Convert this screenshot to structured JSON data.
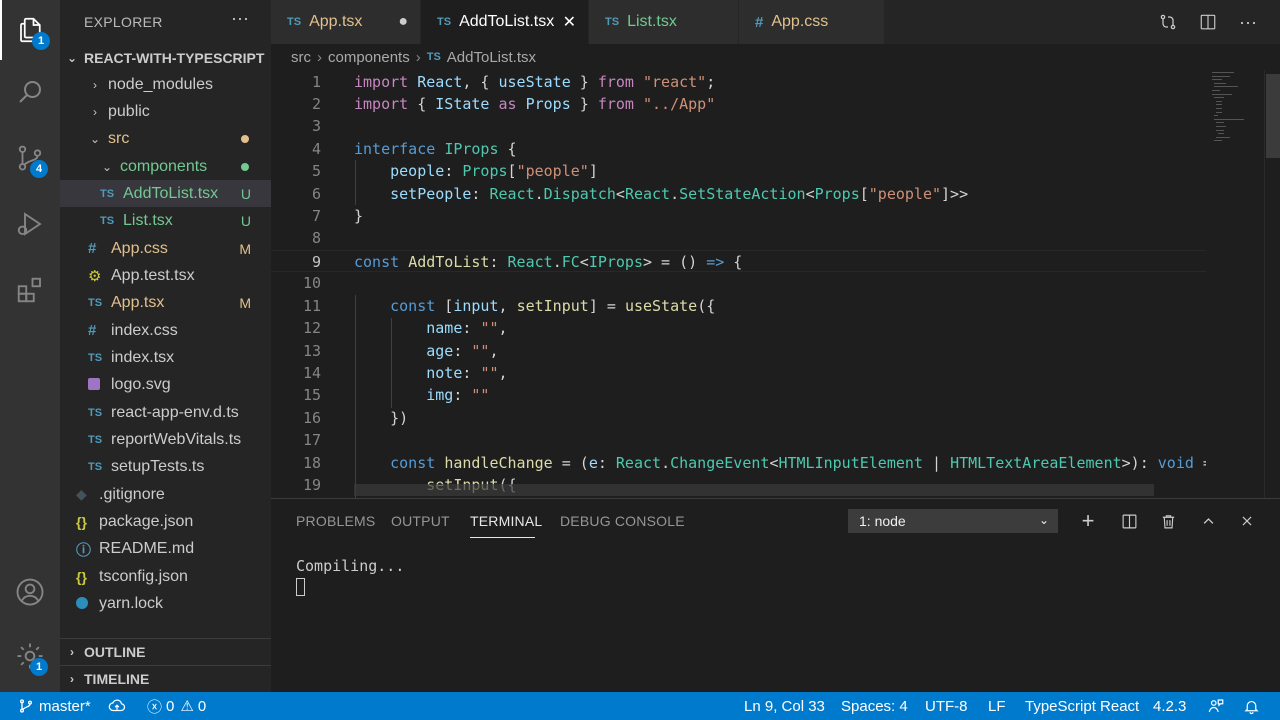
{
  "activity_bar": {
    "explorer_badge": "1",
    "scm_badge": "4",
    "manage_badge": "1"
  },
  "sidebar": {
    "title": "EXPLORER",
    "more": "···",
    "project": "REACT-WITH-TYPESCRIPT",
    "items": [
      {
        "label": "node_modules",
        "icon": "chevron-right",
        "color": "#cccccc"
      },
      {
        "label": "public",
        "icon": "chevron-right",
        "color": "#cccccc"
      },
      {
        "label": "src",
        "icon": "chevron-down",
        "color": "#e2c08d"
      },
      {
        "label": "components",
        "icon": "chevron-down",
        "color": "#73c991"
      },
      {
        "label": "AddToList.tsx",
        "icon": "TS",
        "status": "U",
        "color": "#73c991"
      },
      {
        "label": "List.tsx",
        "icon": "TS",
        "status": "U",
        "color": "#73c991"
      },
      {
        "label": "App.css",
        "icon": "#",
        "status": "M",
        "color": "#e2c08d"
      },
      {
        "label": "App.test.tsx",
        "icon": "gear",
        "color": "#cccccc"
      },
      {
        "label": "App.tsx",
        "icon": "TS",
        "status": "M",
        "color": "#e2c08d"
      },
      {
        "label": "index.css",
        "icon": "#",
        "color": "#cccccc"
      },
      {
        "label": "index.tsx",
        "icon": "TS",
        "color": "#cccccc"
      },
      {
        "label": "logo.svg",
        "icon": "svg",
        "color": "#cccccc"
      },
      {
        "label": "react-app-env.d.ts",
        "icon": "TS",
        "color": "#cccccc"
      },
      {
        "label": "reportWebVitals.ts",
        "icon": "TS",
        "color": "#cccccc"
      },
      {
        "label": "setupTests.ts",
        "icon": "TS",
        "color": "#cccccc"
      },
      {
        "label": ".gitignore",
        "icon": "git",
        "color": "#cccccc"
      },
      {
        "label": "package.json",
        "icon": "{}",
        "color": "#cccccc"
      },
      {
        "label": "README.md",
        "icon": "info",
        "color": "#cccccc"
      },
      {
        "label": "tsconfig.json",
        "icon": "{}",
        "color": "#cccccc"
      },
      {
        "label": "yarn.lock",
        "icon": "yarn",
        "color": "#cccccc"
      }
    ],
    "outline": "OUTLINE",
    "timeline": "TIMELINE"
  },
  "tabs": [
    {
      "icon": "TS",
      "label": "App.tsx",
      "state": "●",
      "active": false,
      "color": "#e2c08d"
    },
    {
      "icon": "TS",
      "label": "AddToList.tsx",
      "state": "✕",
      "active": true,
      "color": "#ffffff"
    },
    {
      "icon": "TS",
      "label": "List.tsx",
      "state": "",
      "active": false,
      "color": "#73c991"
    },
    {
      "icon": "#",
      "label": "App.css",
      "state": "",
      "active": false,
      "color": "#e2c08d"
    }
  ],
  "breadcrumb": {
    "parts": [
      "src",
      "components"
    ],
    "file_icon": "TS",
    "file": "AddToList.tsx"
  },
  "editor": {
    "lines": [
      {
        "n": "1",
        "t": [
          [
            "kwc",
            "import"
          ],
          [
            "plain",
            " "
          ],
          [
            "var",
            "React"
          ],
          [
            "plain",
            ", { "
          ],
          [
            "var",
            "useState"
          ],
          [
            "plain",
            " } "
          ],
          [
            "kwc",
            "from"
          ],
          [
            "plain",
            " "
          ],
          [
            "str",
            "\"react\""
          ],
          [
            "plain",
            ";"
          ]
        ]
      },
      {
        "n": "2",
        "t": [
          [
            "kwc",
            "import"
          ],
          [
            "plain",
            " { "
          ],
          [
            "var",
            "IState"
          ],
          [
            "plain",
            " "
          ],
          [
            "kwc",
            "as"
          ],
          [
            "plain",
            " "
          ],
          [
            "var",
            "Props"
          ],
          [
            "plain",
            " } "
          ],
          [
            "kwc",
            "from"
          ],
          [
            "plain",
            " "
          ],
          [
            "str",
            "\"../App\""
          ]
        ]
      },
      {
        "n": "3",
        "t": []
      },
      {
        "n": "4",
        "t": [
          [
            "kw",
            "interface"
          ],
          [
            "plain",
            " "
          ],
          [
            "typ",
            "IProps"
          ],
          [
            "plain",
            " {"
          ]
        ]
      },
      {
        "n": "5",
        "t": [
          [
            "plain",
            "    "
          ],
          [
            "var",
            "people"
          ],
          [
            "plain",
            ": "
          ],
          [
            "typ",
            "Props"
          ],
          [
            "plain",
            "["
          ],
          [
            "str",
            "\"people\""
          ],
          [
            "plain",
            "]"
          ]
        ]
      },
      {
        "n": "6",
        "t": [
          [
            "plain",
            "    "
          ],
          [
            "var",
            "setPeople"
          ],
          [
            "plain",
            ": "
          ],
          [
            "typ",
            "React"
          ],
          [
            "plain",
            "."
          ],
          [
            "typ",
            "Dispatch"
          ],
          [
            "plain",
            "<"
          ],
          [
            "typ",
            "React"
          ],
          [
            "plain",
            "."
          ],
          [
            "typ",
            "SetStateAction"
          ],
          [
            "plain",
            "<"
          ],
          [
            "typ",
            "Props"
          ],
          [
            "plain",
            "["
          ],
          [
            "str",
            "\"people\""
          ],
          [
            "plain",
            "]>>"
          ]
        ]
      },
      {
        "n": "7",
        "t": [
          [
            "plain",
            "}"
          ]
        ]
      },
      {
        "n": "8",
        "t": []
      },
      {
        "n": "9",
        "t": [
          [
            "kw",
            "const"
          ],
          [
            "plain",
            " "
          ],
          [
            "fn",
            "AddToList"
          ],
          [
            "plain",
            ": "
          ],
          [
            "typ",
            "React"
          ],
          [
            "plain",
            "."
          ],
          [
            "typ",
            "FC"
          ],
          [
            "plain",
            "<"
          ],
          [
            "typ",
            "IProps"
          ],
          [
            "plain",
            "> = () "
          ],
          [
            "kw",
            "=>"
          ],
          [
            "plain",
            " {"
          ]
        ],
        "current": true
      },
      {
        "n": "10",
        "t": []
      },
      {
        "n": "11",
        "t": [
          [
            "plain",
            "    "
          ],
          [
            "kw",
            "const"
          ],
          [
            "plain",
            " ["
          ],
          [
            "var",
            "input"
          ],
          [
            "plain",
            ", "
          ],
          [
            "fn",
            "setInput"
          ],
          [
            "plain",
            "] = "
          ],
          [
            "fn",
            "useState"
          ],
          [
            "plain",
            "({"
          ]
        ]
      },
      {
        "n": "12",
        "t": [
          [
            "plain",
            "        "
          ],
          [
            "var",
            "name"
          ],
          [
            "plain",
            ": "
          ],
          [
            "str",
            "\"\""
          ],
          [
            "plain",
            ","
          ]
        ]
      },
      {
        "n": "13",
        "t": [
          [
            "plain",
            "        "
          ],
          [
            "var",
            "age"
          ],
          [
            "plain",
            ": "
          ],
          [
            "str",
            "\"\""
          ],
          [
            "plain",
            ","
          ]
        ]
      },
      {
        "n": "14",
        "t": [
          [
            "plain",
            "        "
          ],
          [
            "var",
            "note"
          ],
          [
            "plain",
            ": "
          ],
          [
            "str",
            "\"\""
          ],
          [
            "plain",
            ","
          ]
        ]
      },
      {
        "n": "15",
        "t": [
          [
            "plain",
            "        "
          ],
          [
            "var",
            "img"
          ],
          [
            "plain",
            ": "
          ],
          [
            "str",
            "\"\""
          ]
        ]
      },
      {
        "n": "16",
        "t": [
          [
            "plain",
            "    })"
          ]
        ]
      },
      {
        "n": "17",
        "t": []
      },
      {
        "n": "18",
        "t": [
          [
            "plain",
            "    "
          ],
          [
            "kw",
            "const"
          ],
          [
            "plain",
            " "
          ],
          [
            "fn",
            "handleChange"
          ],
          [
            "plain",
            " = ("
          ],
          [
            "var",
            "e"
          ],
          [
            "plain",
            ": "
          ],
          [
            "typ",
            "React"
          ],
          [
            "plain",
            "."
          ],
          [
            "typ",
            "ChangeEvent"
          ],
          [
            "plain",
            "<"
          ],
          [
            "typ",
            "HTMLInputElement"
          ],
          [
            "plain",
            " | "
          ],
          [
            "typ",
            "HTMLTextAreaElement"
          ],
          [
            "plain",
            ">): "
          ],
          [
            "kw",
            "void"
          ],
          [
            "plain",
            " ="
          ]
        ]
      },
      {
        "n": "19",
        "t": [
          [
            "plain",
            "        "
          ],
          [
            "fn",
            "setInput"
          ],
          [
            "plain",
            "({"
          ]
        ]
      }
    ]
  },
  "panel": {
    "tabs": [
      "PROBLEMS",
      "OUTPUT",
      "TERMINAL",
      "DEBUG CONSOLE"
    ],
    "active_tab": "TERMINAL",
    "terminal_select": "1: node",
    "output": "Compiling..."
  },
  "statusbar": {
    "branch": "master*",
    "errors": "0",
    "warnings": "0",
    "position": "Ln 9, Col 33",
    "spaces": "Spaces: 4",
    "encoding": "UTF-8",
    "eol": "LF",
    "language": "TypeScript React",
    "version": "4.2.3"
  }
}
